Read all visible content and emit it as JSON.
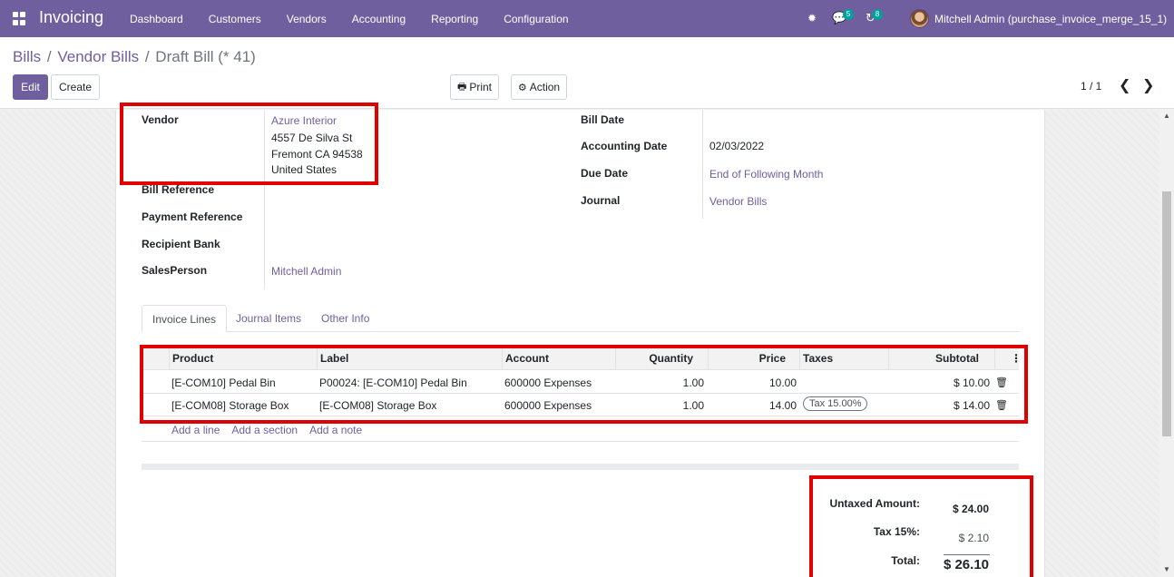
{
  "navbar": {
    "app_name": "Invoicing",
    "menu": [
      "Dashboard",
      "Customers",
      "Vendors",
      "Accounting",
      "Reporting",
      "Configuration"
    ],
    "messages_count": "5",
    "activities_count": "8",
    "user": "Mitchell Admin (purchase_invoice_merge_15_1)"
  },
  "breadcrumb": {
    "items": [
      "Bills",
      "Vendor Bills"
    ],
    "current": "Draft Bill (* 41)"
  },
  "toolbar": {
    "edit": "Edit",
    "create": "Create",
    "print": "Print",
    "action": "Action",
    "pager": "1 / 1"
  },
  "form": {
    "vendor_label": "Vendor",
    "vendor_name": "Azure Interior",
    "vendor_address": [
      "4557 De Silva St",
      "Fremont CA 94538",
      "United States"
    ],
    "bill_reference_label": "Bill Reference",
    "payment_reference_label": "Payment Reference",
    "recipient_bank_label": "Recipient Bank",
    "salesperson_label": "SalesPerson",
    "salesperson": "Mitchell Admin",
    "bill_date_label": "Bill Date",
    "accounting_date_label": "Accounting Date",
    "accounting_date": "02/03/2022",
    "due_date_label": "Due Date",
    "due_date": "End of Following Month",
    "journal_label": "Journal",
    "journal": "Vendor Bills"
  },
  "tabs": [
    "Invoice Lines",
    "Journal Items",
    "Other Info"
  ],
  "table": {
    "columns": [
      "Product",
      "Label",
      "Account",
      "Quantity",
      "Price",
      "Taxes",
      "Subtotal"
    ],
    "rows": [
      {
        "product": "[E-COM10] Pedal Bin",
        "label": "P00024: [E-COM10] Pedal Bin",
        "account": "600000 Expenses",
        "quantity": "1.00",
        "price": "10.00",
        "taxes": "",
        "subtotal": "$ 10.00"
      },
      {
        "product": "[E-COM08] Storage Box",
        "label": "[E-COM08] Storage Box",
        "account": "600000 Expenses",
        "quantity": "1.00",
        "price": "14.00",
        "taxes": "Tax 15.00%",
        "subtotal": "$ 14.00"
      }
    ],
    "add_line": "Add a line",
    "add_section": "Add a section",
    "add_note": "Add a note"
  },
  "totals": {
    "untaxed_label": "Untaxed Amount:",
    "untaxed_value": "$ 24.00",
    "tax_label": "Tax 15%:",
    "tax_value": "$ 2.10",
    "total_label": "Total:",
    "total_value": "$ 26.10"
  },
  "colors": {
    "brand": "#6f5f9e",
    "highlight": "#e00000",
    "badge": "#00a09d"
  }
}
